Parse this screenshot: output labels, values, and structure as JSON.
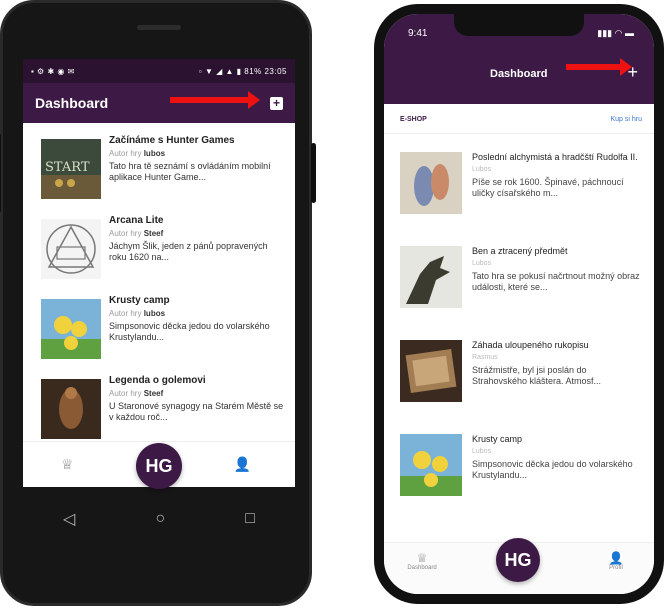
{
  "android": {
    "status_left": "▪ ⚙ ✱ ◉ ✉",
    "status_right": "▫ ▼ ◢ ▲ ▮ 81% 23:05",
    "title": "Dashboard",
    "add_icon": "plus-square-icon",
    "games": [
      {
        "name": "Začínáme s Hunter Games",
        "author_label": "Autor hry",
        "author": "lubos",
        "desc": "Tato hra tě seznámí s ovládáním mobilní aplikace Hunter Game..."
      },
      {
        "name": "Arcana Lite",
        "author_label": "Autor hry",
        "author": "Steef",
        "desc": "Jáchym Šlik, jeden z pánů popravených roku 1620 na..."
      },
      {
        "name": "Krusty camp",
        "author_label": "Autor hry",
        "author": "lubos",
        "desc": "Simpsonovic děcka jedou do volarského Krustylandu..."
      },
      {
        "name": "Legenda o golemovi",
        "author_label": "Autor hry",
        "author": "Steef",
        "desc": "U Staronové synagogy na Starém Městě se v každou roč..."
      }
    ],
    "thumb_text_start": "START",
    "tab_icons": [
      "crown-icon",
      "hg-logo-icon",
      "user-icon"
    ],
    "fab_label": "HG",
    "nav": [
      "◁",
      "○",
      "□"
    ]
  },
  "iphone": {
    "time": "9:41",
    "signal": "▮▮▮ ◠ ▬",
    "title": "Dashboard",
    "section": "E-SHOP",
    "buy_link": "Kup si hru",
    "games": [
      {
        "name": "Poslední alchymistá a hradčští Rudolfa II.",
        "author": "Lubos",
        "desc": "Píše se rok 1600. Špinavé, páchnoucí uličky císařského m..."
      },
      {
        "name": "Ben a ztracený předmět",
        "author": "Lubos",
        "desc": "Tato hra se pokusí načrtnout možný obraz události, které se..."
      },
      {
        "name": "Záhada uloupeného rukopisu",
        "author": "Rasmus",
        "desc": "Strážmistře, byl jsi poslán do Strahovského kláštera. Atmosf..."
      },
      {
        "name": "Krusty camp",
        "author": "Lubos",
        "desc": "Simpsonovic děcka jedou do volarského Krustylandu..."
      }
    ],
    "tabs": [
      {
        "label": "Dashboard"
      },
      {
        "label": "Profil"
      }
    ],
    "fab_label": "HG"
  },
  "colors": {
    "brand": "#3d1a45",
    "arrow": "#e11111"
  }
}
